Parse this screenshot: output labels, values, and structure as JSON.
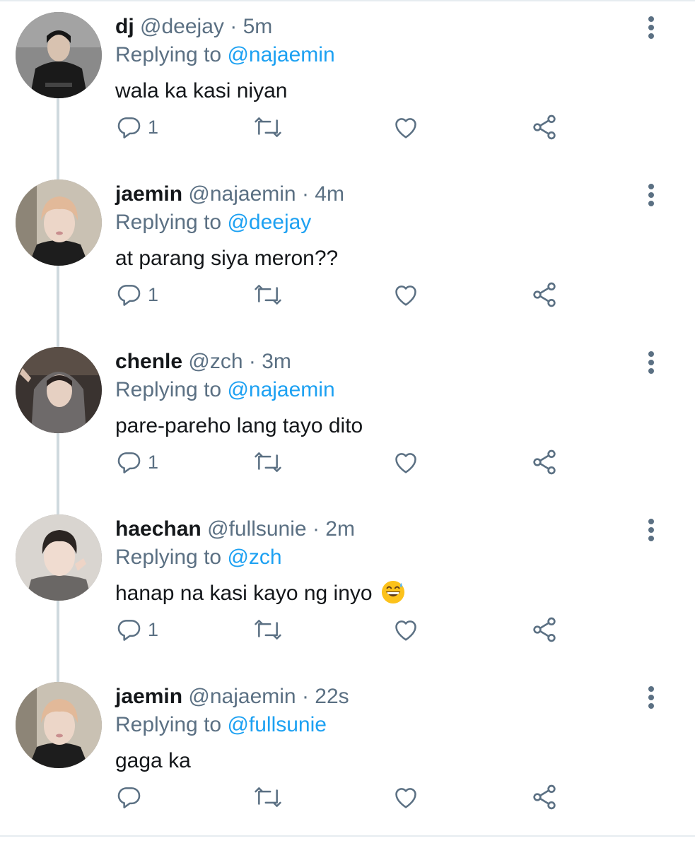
{
  "replying_prefix": "Replying to",
  "tweets": [
    {
      "name": "dj",
      "handle": "@deejay",
      "time": "5m",
      "replying_to": "@najaemin",
      "text": "wala ka kasi niyan",
      "reply_count": "1",
      "avatar_icon": "avatar-dark-outfit"
    },
    {
      "name": "jaemin",
      "handle": "@najaemin",
      "time": "4m",
      "replying_to": "@deejay",
      "text": "at parang siya meron??",
      "reply_count": "1",
      "avatar_icon": "avatar-blonde-hair"
    },
    {
      "name": "chenle",
      "handle": "@zch",
      "time": "3m",
      "replying_to": "@najaemin",
      "text": "pare-pareho lang tayo dito",
      "reply_count": "1",
      "avatar_icon": "avatar-hoodie"
    },
    {
      "name": "haechan",
      "handle": "@fullsunie",
      "time": "2m",
      "replying_to": "@zch",
      "text": "hanap na kasi kayo ng inyo",
      "reply_count": "1",
      "avatar_icon": "avatar-dark-hair"
    },
    {
      "name": "jaemin",
      "handle": "@najaemin",
      "time": "22s",
      "replying_to": "@fullsunie",
      "text": "gaga ka",
      "reply_count": "",
      "avatar_icon": "avatar-blonde-hair"
    }
  ],
  "icons": {
    "reply": "reply-icon",
    "retweet": "retweet-icon",
    "like": "heart-icon",
    "share": "share-icon",
    "more": "more-vertical-icon",
    "emoji": "grinning-sweat-emoji"
  },
  "colors": {
    "text": "#14171a",
    "secondary": "#5b7083",
    "mention": "#1da1f2",
    "thread_line": "#cfd9de"
  }
}
